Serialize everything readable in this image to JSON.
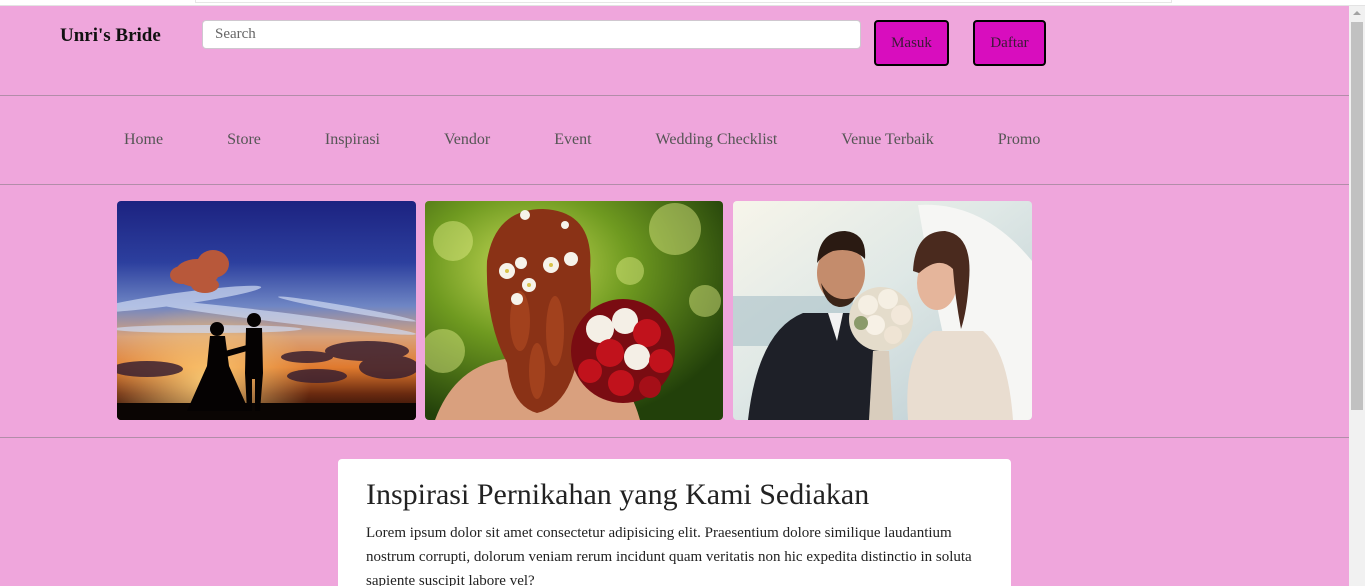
{
  "header": {
    "brand": "Unri's Bride",
    "search_placeholder": "Search",
    "login_label": "Masuk",
    "register_label": "Daftar"
  },
  "nav": {
    "items": [
      "Home",
      "Store",
      "Inspirasi",
      "Vendor",
      "Event",
      "Wedding Checklist",
      "Venue Terbaik",
      "Promo"
    ]
  },
  "card": {
    "title": "Inspirasi Pernikahan yang Kami Sediakan",
    "body": "Lorem ipsum dolor sit amet consectetur adipisicing elit. Praesentium dolore similique laudantium nostrum corrupti, dolorum veniam rerum incidunt quam veritatis non hic expedita distinctio in soluta sapiente suscipit labore vel?"
  },
  "icons": {
    "scrollbar_up": "triangle-up-icon"
  },
  "colors": {
    "page_background": "#EFA6DC",
    "button_background": "#D80DBE",
    "divider": "#B28DA9",
    "card_background": "#FFFFFF"
  }
}
